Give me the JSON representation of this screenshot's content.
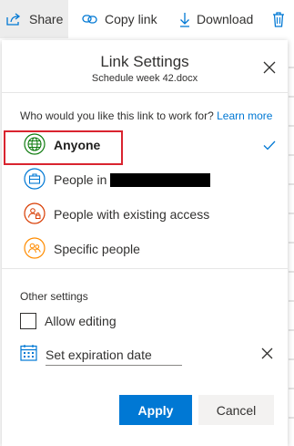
{
  "toolbar": {
    "share_label": "Share",
    "copy_link_label": "Copy link",
    "download_label": "Download"
  },
  "panel": {
    "title": "Link Settings",
    "subtitle": "Schedule week 42.docx",
    "question": "Who would you like this link to work for?",
    "learn_more": "Learn more",
    "options": [
      {
        "label": "Anyone",
        "selected": true,
        "icon": "globe-icon",
        "color": "#107c10"
      },
      {
        "label": "People in",
        "redacted": true,
        "icon": "briefcase-icon",
        "color": "#0078d4"
      },
      {
        "label": "People with existing access",
        "icon": "people-lock-icon",
        "color": "#d83b01"
      },
      {
        "label": "Specific people",
        "icon": "people-icon",
        "color": "#ff8c00"
      }
    ],
    "other_settings_title": "Other settings",
    "allow_editing_label": "Allow editing",
    "allow_editing_checked": false,
    "expiration_placeholder": "Set expiration date",
    "apply_label": "Apply",
    "cancel_label": "Cancel"
  },
  "colors": {
    "accent": "#0078d4",
    "highlight": "#d9242f"
  }
}
